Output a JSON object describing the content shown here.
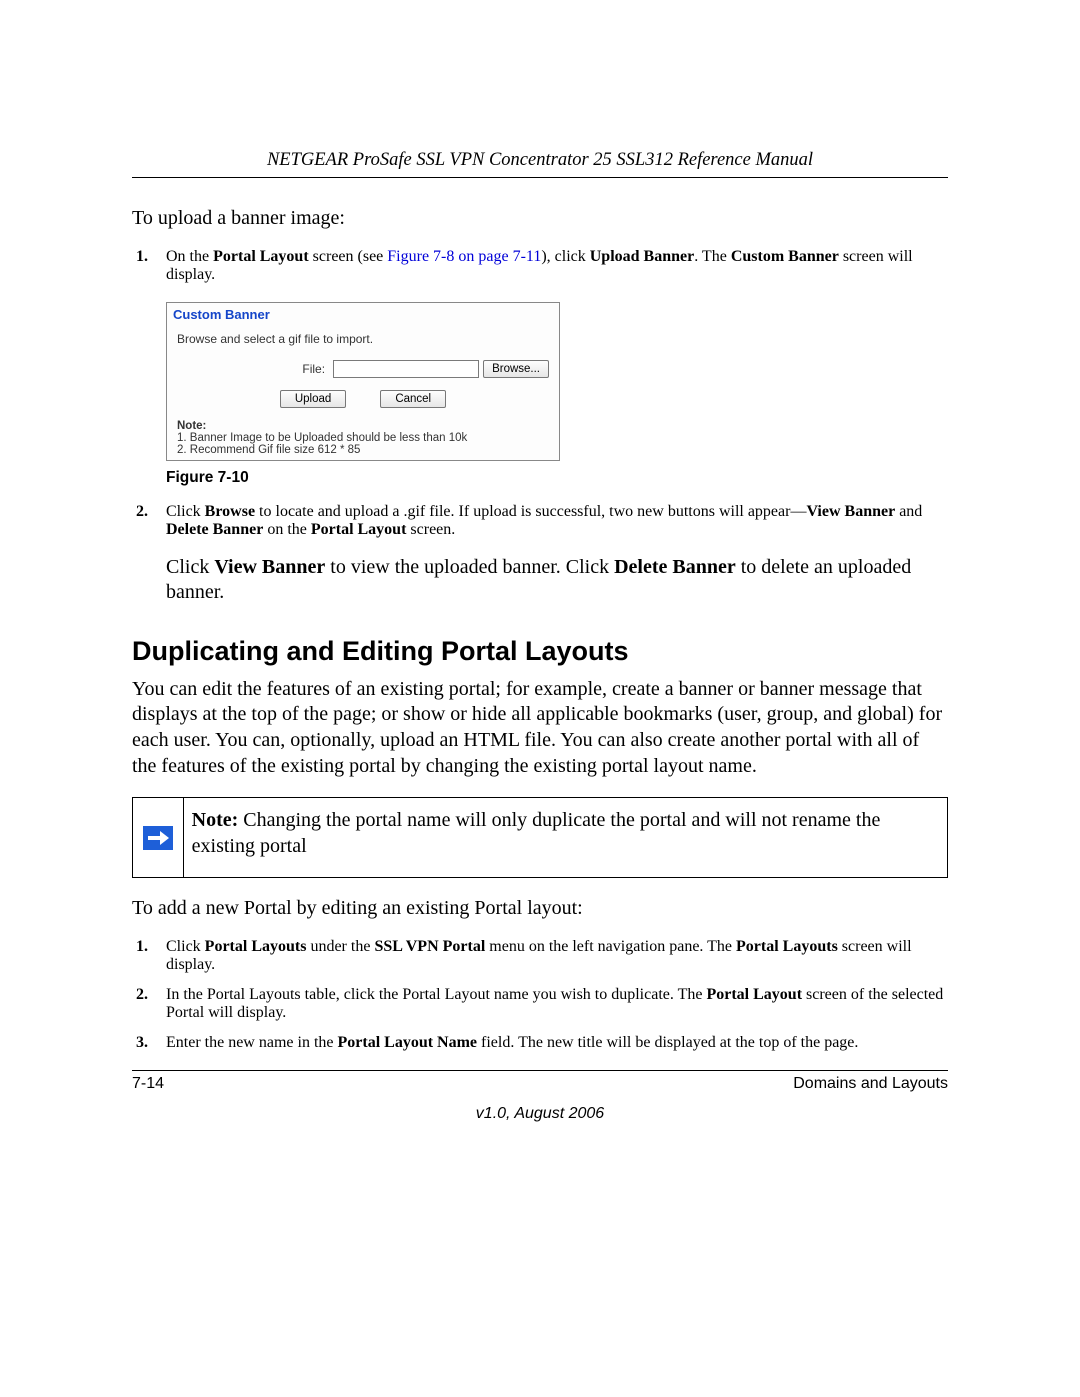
{
  "header": {
    "running_head": "NETGEAR ProSafe SSL VPN Concentrator 25 SSL312 Reference Manual"
  },
  "intro": {
    "upload_intro": "To upload a banner image:"
  },
  "step1": {
    "num": "1.",
    "pre": "On the ",
    "b1": "Portal Layout",
    "mid1": " screen (see ",
    "link": "Figure 7-8 on page 7-11",
    "mid2": "), click ",
    "b2": "Upload Banner",
    "mid3": ". The ",
    "b3": "Custom Banner",
    "tail": " screen will display."
  },
  "figure": {
    "caption": "Figure 7-10",
    "shot": {
      "title": "Custom Banner",
      "instruction": "Browse and select a gif file to import.",
      "file_label": "File:",
      "file_value": "",
      "browse": "Browse...",
      "upload": "Upload",
      "cancel": "Cancel",
      "note_hd": "Note:",
      "note1": "1. Banner Image to be Uploaded should be less than 10k",
      "note2": "2. Recommend Gif file size 612 * 85"
    }
  },
  "step2": {
    "num": "2.",
    "pre": "Click ",
    "b1": "Browse",
    "mid1": " to locate and upload a .gif file. If upload is successful, two new buttons will appear—",
    "b2": "View Banner",
    "mid2": " and ",
    "b3": "Delete Banner",
    "mid3": " on the ",
    "b4": "Portal Layout",
    "tail": " screen."
  },
  "step2b": {
    "pre": "Click ",
    "b1": "View Banner",
    "mid1": " to view the uploaded banner. Click ",
    "b2": "Delete Banner",
    "tail": " to delete an uploaded banner."
  },
  "section": {
    "heading": "Duplicating and Editing Portal Layouts",
    "para": "You can edit the features of an existing portal; for example, create a banner or banner message that displays at the top of the page; or show or hide all applicable bookmarks (user, group, and global) for each user. You can, optionally, upload an HTML file. You can also create another portal with all of the features of the existing portal by changing the existing portal layout name."
  },
  "notebox": {
    "b": "Note:",
    "text": " Changing the portal name will only duplicate the portal and will not rename the existing portal"
  },
  "add_intro": "To add a new Portal by editing an existing Portal layout:",
  "a1": {
    "num": "1.",
    "pre": "Click ",
    "b1": "Portal Layouts",
    "mid1": " under the ",
    "b2": "SSL VPN Portal",
    "mid2": " menu on the left navigation pane. The ",
    "b3": "Portal Layouts",
    "tail": " screen will display."
  },
  "a2": {
    "num": "2.",
    "pre": "In the Portal Layouts table, click the Portal Layout name you wish to duplicate. The ",
    "b1": "Portal Layout",
    "tail": " screen of the selected Portal will display."
  },
  "a3": {
    "num": "3.",
    "pre": "Enter the new name in the ",
    "b1": "Portal Layout Name",
    "tail": " field. The new title will be displayed at the top of the page."
  },
  "footer": {
    "page": "7-14",
    "section": "Domains and Layouts",
    "version": "v1.0, August 2006"
  }
}
